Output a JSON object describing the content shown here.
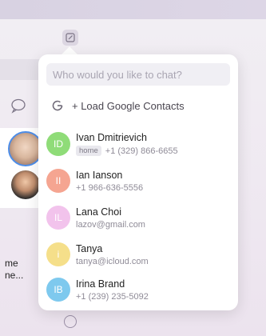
{
  "search": {
    "placeholder": "Who would you like to chat?"
  },
  "google_contacts": {
    "label": "+ Load Google Contacts"
  },
  "contacts": [
    {
      "initials": "ID",
      "name": "Ivan Dmitrievich",
      "tag": "home",
      "detail": "+1 (329) 866-6655",
      "color": "#8fdc78"
    },
    {
      "initials": "II",
      "name": "Ian Ianson",
      "tag": "",
      "detail": "+1 966-636-5556",
      "color": "#f5a591"
    },
    {
      "initials": "IL",
      "name": "Lana Choi",
      "tag": "",
      "detail": "lazov@gmail.com",
      "color": "#f2c3ec"
    },
    {
      "initials": "i",
      "name": "Tanya",
      "tag": "",
      "detail": "tanya@icloud.com",
      "color": "#f5df8a"
    },
    {
      "initials": "IB",
      "name": "Irina Brand",
      "tag": "",
      "detail": "+1 (239) 235-5092",
      "color": "#7ec9ee"
    }
  ],
  "background": {
    "label_line1": "me",
    "label_line2": "ne..."
  }
}
